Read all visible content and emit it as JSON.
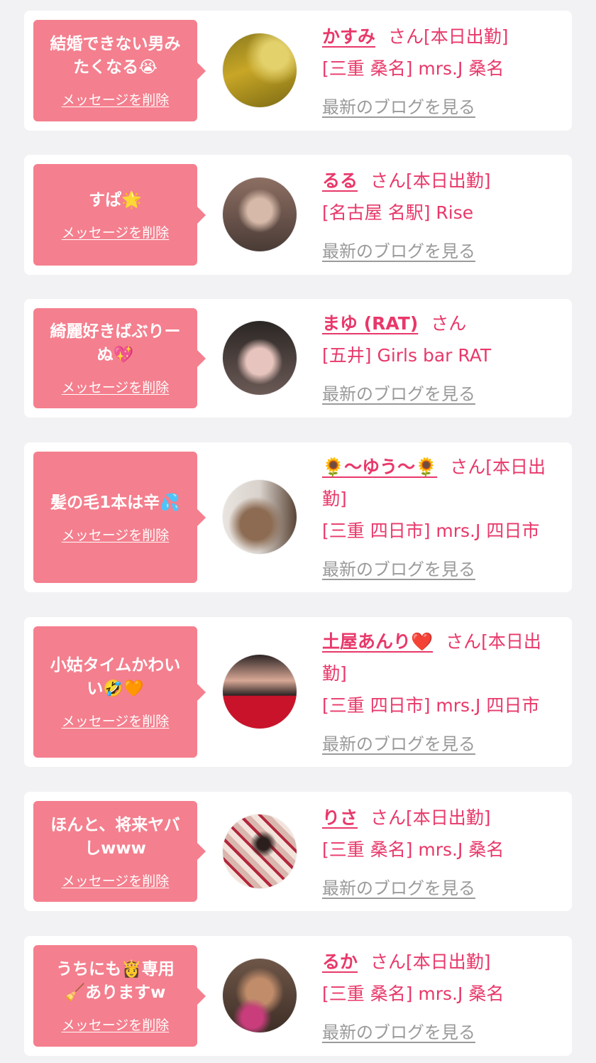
{
  "items": [
    {
      "message_line1": "結婚できない男み",
      "message_line2": "たくなる😭",
      "delete_label": "メッセージを削除",
      "name": "かすみ",
      "san": "さん",
      "status": "[本日出勤]",
      "shop": "[三重 桑名] mrs.J 桑名",
      "blog_label": "最新のブログを見る",
      "avatar_colors": [
        "#c8a626",
        "#8a7a1e",
        "#e3d16c"
      ]
    },
    {
      "message_line1": "すぱ🌟",
      "message_line2": "",
      "delete_label": "メッセージを削除",
      "name": "るる",
      "san": "さん",
      "status": "[本日出勤]",
      "shop": "[名古屋 名駅] Rise",
      "blog_label": "最新のブログを見る",
      "avatar_colors": [
        "#4a3b36",
        "#d6b9a8",
        "#8d6f63"
      ]
    },
    {
      "message_line1": "綺麗好きばぶりー",
      "message_line2": "ぬ💖",
      "delete_label": "メッセージを削除",
      "name": "まゆ (RAT)",
      "san": "さん",
      "status": "",
      "shop": "[五井] Girls bar RAT",
      "blog_label": "最新のブログを見る",
      "avatar_colors": [
        "#2b2624",
        "#e7c4bd",
        "#6b5a56"
      ]
    },
    {
      "message_line1": "髪の毛1本は辛💦",
      "message_line2": "",
      "delete_label": "メッセージを削除",
      "name": "🌻〜ゆう〜🌻",
      "san": "さん",
      "status": "[本日出勤]",
      "shop": "[三重 四日市] mrs.J 四日市",
      "blog_label": "最新のブログを見る",
      "avatar_colors": [
        "#e9e4df",
        "#8c6b52",
        "#5a4536"
      ]
    },
    {
      "message_line1": "小姑タイムかわい",
      "message_line2": "い🤣🧡",
      "delete_label": "メッセージを削除",
      "name": "土屋あんり❤️",
      "san": "さん",
      "status": "[本日出勤]",
      "shop": "[三重 四日市] mrs.J 四日市",
      "blog_label": "最新のブログを見る",
      "avatar_colors": [
        "#2d2424",
        "#c8132a",
        "#d8a896"
      ]
    },
    {
      "message_line1": "ほんと、将来ヤバ",
      "message_line2": "しwww",
      "delete_label": "メッセージを削除",
      "name": "りさ",
      "san": "さん",
      "status": "[本日出勤]",
      "shop": "[三重 桑名] mrs.J 桑名",
      "blog_label": "最新のブログを見る",
      "avatar_colors": [
        "#d9b7ae",
        "#b2273c",
        "#f3e3db"
      ]
    },
    {
      "message_line1": "うちにも👸専用",
      "message_line2": "🧹ありますw",
      "delete_label": "メッセージを削除",
      "name": "るか",
      "san": "さん",
      "status": "[本日出勤]",
      "shop": "[三重 桑名] mrs.J 桑名",
      "blog_label": "最新のブログを見る",
      "avatar_colors": [
        "#6e5648",
        "#c08c6a",
        "#c93d7c"
      ]
    }
  ],
  "colors": {
    "page_bg": "#f2f2f4",
    "card_bg": "#ffffff",
    "bubble": "#f47f8e",
    "accent_text": "#e8386a",
    "link_gray": "#9a9a9a"
  }
}
